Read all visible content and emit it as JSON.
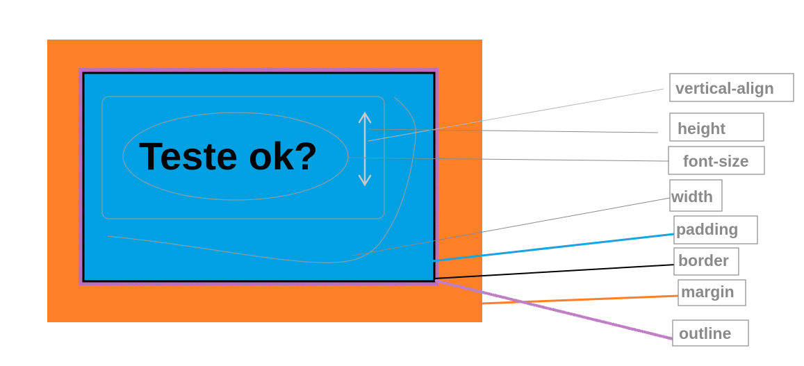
{
  "sample_text": "Teste ok?",
  "labels": {
    "vertical_align": "vertical-align",
    "height": "height",
    "font_size": "font-size",
    "width": "width",
    "padding": "padding",
    "border": "border",
    "margin": "margin",
    "outline": "outline"
  },
  "colors": {
    "margin": "#fd7f28",
    "padding": "#00a0e3",
    "border": "#000000",
    "outline": "#b86fbb",
    "guide": "#8a8a8a",
    "label_text": "#8a8a8a"
  }
}
